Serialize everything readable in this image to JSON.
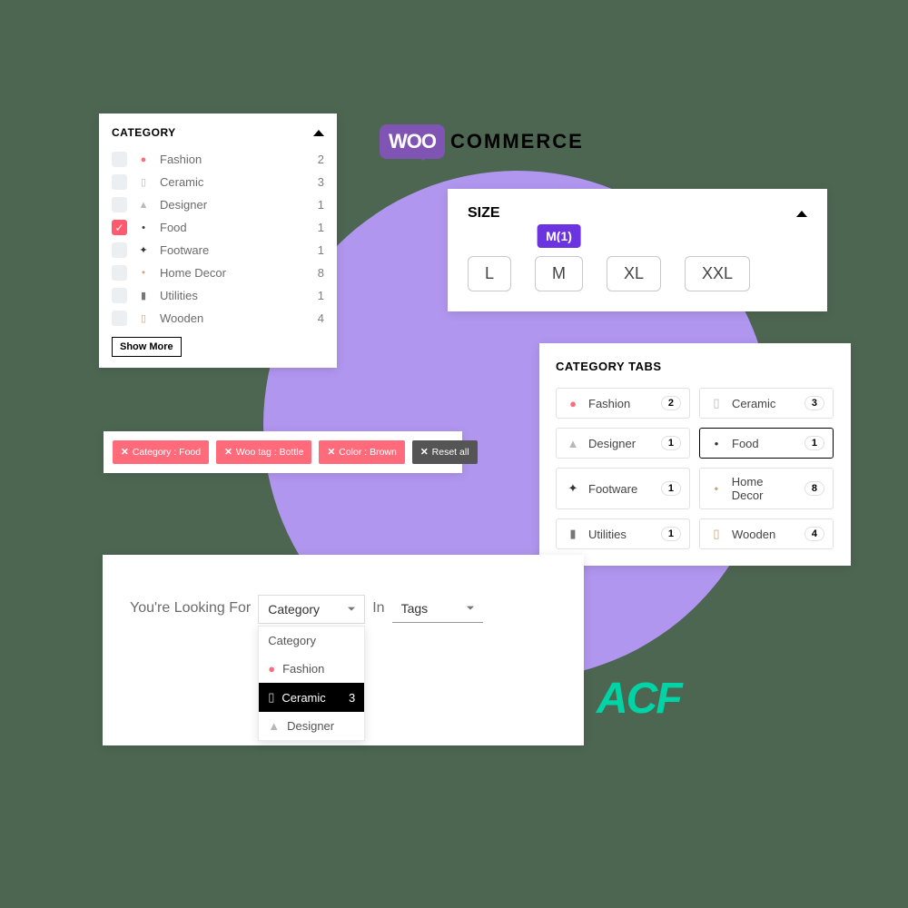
{
  "logos": {
    "woo_bubble": "WOO",
    "woo_text": "COMMERCE",
    "acf": "ACF"
  },
  "category_panel": {
    "title": "CATEGORY",
    "items": [
      {
        "label": "Fashion",
        "count": "2",
        "checked": false,
        "icon": "●",
        "icon_color": "#ff6b7b"
      },
      {
        "label": "Ceramic",
        "count": "3",
        "checked": false,
        "icon": "▯",
        "icon_color": "#b8b8b8"
      },
      {
        "label": "Designer",
        "count": "1",
        "checked": false,
        "icon": "▲",
        "icon_color": "#b8b8b8"
      },
      {
        "label": "Food",
        "count": "1",
        "checked": true,
        "icon": "•",
        "icon_color": "#333"
      },
      {
        "label": "Footware",
        "count": "1",
        "checked": false,
        "icon": "✦",
        "icon_color": "#333"
      },
      {
        "label": "Home Decor",
        "count": "8",
        "checked": false,
        "icon": "⬩",
        "icon_color": "#c9a37a"
      },
      {
        "label": "Utilities",
        "count": "1",
        "checked": false,
        "icon": "▮",
        "icon_color": "#777"
      },
      {
        "label": "Wooden",
        "count": "4",
        "checked": false,
        "icon": "▯",
        "icon_color": "#c9a37a"
      }
    ],
    "show_more": "Show More"
  },
  "size_panel": {
    "title": "SIZE",
    "tooltip": "M(1)",
    "options": [
      {
        "label": "L"
      },
      {
        "label": "M",
        "active": true
      },
      {
        "label": "XL"
      },
      {
        "label": "XXL"
      }
    ]
  },
  "chips": {
    "items": [
      {
        "label": "Category : Food"
      },
      {
        "label": "Woo tag : Bottle"
      },
      {
        "label": "Color : Brown"
      }
    ],
    "reset": "Reset all"
  },
  "tabs_panel": {
    "title": "CATEGORY TABS",
    "items": [
      {
        "label": "Fashion",
        "count": "2",
        "icon": "●",
        "icon_color": "#ff6b7b"
      },
      {
        "label": "Ceramic",
        "count": "3",
        "icon": "▯",
        "icon_color": "#b8b8b8"
      },
      {
        "label": "Designer",
        "count": "1",
        "icon": "▲",
        "icon_color": "#b8b8b8"
      },
      {
        "label": "Food",
        "count": "1",
        "icon": "•",
        "icon_color": "#333",
        "selected": true
      },
      {
        "label": "Footware",
        "count": "1",
        "icon": "✦",
        "icon_color": "#333"
      },
      {
        "label": "Home Decor",
        "count": "8",
        "icon": "⬩",
        "icon_color": "#c9a37a"
      },
      {
        "label": "Utilities",
        "count": "1",
        "icon": "▮",
        "icon_color": "#777"
      },
      {
        "label": "Wooden",
        "count": "4",
        "icon": "▯",
        "icon_color": "#c9a37a"
      }
    ]
  },
  "looking": {
    "prefix": "You're Looking For",
    "in": "In",
    "select1": "Category",
    "select2": "Tags",
    "dropdown": {
      "header": "Category",
      "items": [
        {
          "label": "Fashion",
          "icon": "●",
          "icon_color": "#ff6b7b"
        },
        {
          "label": "Ceramic",
          "icon": "▯",
          "icon_color": "#d0d0d0",
          "count": "3",
          "selected": true
        },
        {
          "label": "Designer",
          "icon": "▲",
          "icon_color": "#b8b8b8"
        }
      ]
    }
  }
}
